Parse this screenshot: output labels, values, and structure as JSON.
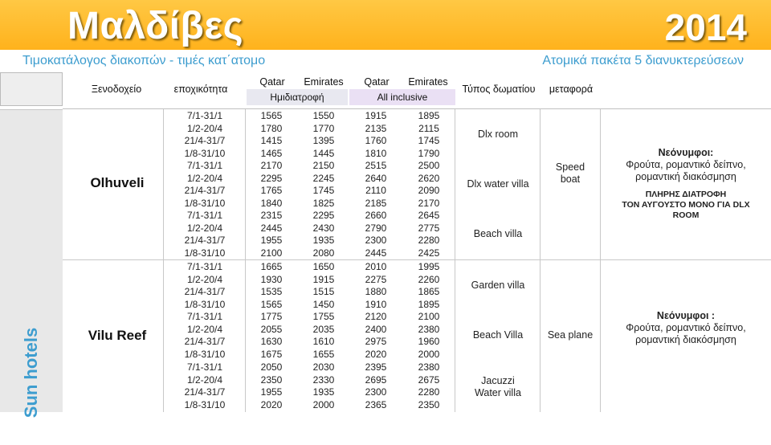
{
  "title": "Μαλδίβες",
  "year": "2014",
  "subtitle_left": "Τιμοκατάλογος διακοπών  - τιμές κατ΄ατομο",
  "subtitle_right": "Ατομικά πακέτα 5 διανυκτερεύσεων",
  "group_label": "Sun hotels",
  "headers": {
    "hotel": "Ξενοδοχείο",
    "season": "εποχικότητα",
    "qatar": "Qatar",
    "emirates": "Emirates",
    "half_board": "Ημιδιατροφή",
    "all_inclusive": "All inclusive",
    "room_type": "Τύπος δωματίου",
    "transfer": "μεταφορά"
  },
  "hotels": [
    {
      "name": "Olhuveli",
      "transfer": [
        "Speed",
        "boat"
      ],
      "note_title": "Νεόνυμφοι:",
      "note_lines": [
        "Φρούτα, ρομαντικό δείπνο,",
        "ρομαντική διακόσμηση"
      ],
      "note_extra": [
        "ΠΛΗΡΗΣ ΔΙΑΤΡΟΦΗ",
        "ΤΟΝ ΑΥΓΟΥΣΤΟ ΜΟΝΟ ΓΙΑ DLX",
        "ROOM"
      ]
    },
    {
      "name": "Vilu Reef",
      "transfer": [
        "Sea plane"
      ],
      "note_title": "Νεόνυμφοι :",
      "note_lines": [
        "Φρούτα, ρομαντικό δείπνο,",
        "ρομαντική διακόσμηση"
      ],
      "note_extra": []
    }
  ],
  "seasons": [
    "7/1-31/1",
    "1/2-20/4",
    "21/4-31/7",
    "1/8-31/10"
  ],
  "rooms": [
    {
      "room": [
        "Dlx room"
      ],
      "qatar_hb": [
        "1565",
        "1780",
        "1415",
        "1465"
      ],
      "emirates_hb": [
        "1550",
        "1770",
        "1395",
        "1445"
      ],
      "qatar_ai": [
        "1915",
        "2135",
        "1760",
        "1810"
      ],
      "emirates_ai": [
        "1895",
        "2115",
        "1745",
        "1790"
      ]
    },
    {
      "room": [
        "Dlx water villa"
      ],
      "qatar_hb": [
        "2170",
        "2295",
        "1765",
        "1840"
      ],
      "emirates_hb": [
        "2150",
        "2245",
        "1745",
        "1825"
      ],
      "qatar_ai": [
        "2515",
        "2640",
        "2110",
        "2185"
      ],
      "emirates_ai": [
        "2500",
        "2620",
        "2090",
        "2170"
      ]
    },
    {
      "room": [
        "Beach villa"
      ],
      "qatar_hb": [
        "2315",
        "2445",
        "1955",
        "2100"
      ],
      "emirates_hb": [
        "2295",
        "2430",
        "1935",
        "2080"
      ],
      "qatar_ai": [
        "2660",
        "2790",
        "2300",
        "2445"
      ],
      "emirates_ai": [
        "2645",
        "2775",
        "2280",
        "2425"
      ]
    },
    {
      "room": [
        "Garden  villa"
      ],
      "qatar_hb": [
        "1665",
        "1930",
        "1535",
        "1565"
      ],
      "emirates_hb": [
        "1650",
        "1915",
        "1515",
        "1450"
      ],
      "qatar_ai": [
        "2010",
        "2275",
        "1880",
        "1910"
      ],
      "emirates_ai": [
        "1995",
        "2260",
        "1865",
        "1895"
      ]
    },
    {
      "room": [
        "Beach  Villa"
      ],
      "qatar_hb": [
        "1775",
        "2055",
        "1630",
        "1675"
      ],
      "emirates_hb": [
        "1755",
        "2035",
        "1610",
        "1655"
      ],
      "qatar_ai": [
        "2120",
        "2400",
        "2975",
        "2020"
      ],
      "emirates_ai": [
        "2100",
        "2380",
        "1960",
        "2000"
      ]
    },
    {
      "room": [
        "Jacuzzi",
        "Water villa"
      ],
      "qatar_hb": [
        "2050",
        "2350",
        "1955",
        "2020"
      ],
      "emirates_hb": [
        "2030",
        "2330",
        "1935",
        "2000"
      ],
      "qatar_ai": [
        "2395",
        "2695",
        "2300",
        "2365"
      ],
      "emirates_ai": [
        "2380",
        "2675",
        "2280",
        "2350"
      ]
    }
  ]
}
